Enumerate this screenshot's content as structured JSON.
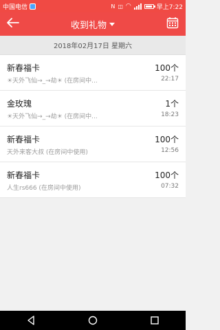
{
  "status_bar": {
    "carrier": "中国电信",
    "time_label": "早上7:22"
  },
  "header": {
    "title": "收到礼物"
  },
  "date_bar": {
    "text": "2018年02月17日 星期六"
  },
  "items": [
    {
      "name": "新春福卡",
      "count": "100个",
      "sender": "☀天外飞仙→_→劫☀ (在房间中...",
      "time": "22:17"
    },
    {
      "name": "金玫瑰",
      "count": "1个",
      "sender": "☀天外飞仙→_→劫☀ (在房间中...",
      "time": "18:23"
    },
    {
      "name": "新春福卡",
      "count": "100个",
      "sender": "天外来客大叔 (在房间中使用)",
      "time": "12:56"
    },
    {
      "name": "新春福卡",
      "count": "100个",
      "sender": "人生rs666 (在房间中使用)",
      "time": "07:32"
    }
  ],
  "icons": {
    "back": "back-arrow-icon",
    "dropdown": "chevron-down-icon",
    "calendar": "calendar-icon",
    "nav_back": "nav-back-icon",
    "nav_home": "nav-home-icon",
    "nav_recent": "nav-recent-icon"
  },
  "colors": {
    "accent": "#ef4a47",
    "status_bar": "#f04a44",
    "date_bar_bg": "#e9e9e9",
    "page_bg": "#f1f1f1"
  }
}
